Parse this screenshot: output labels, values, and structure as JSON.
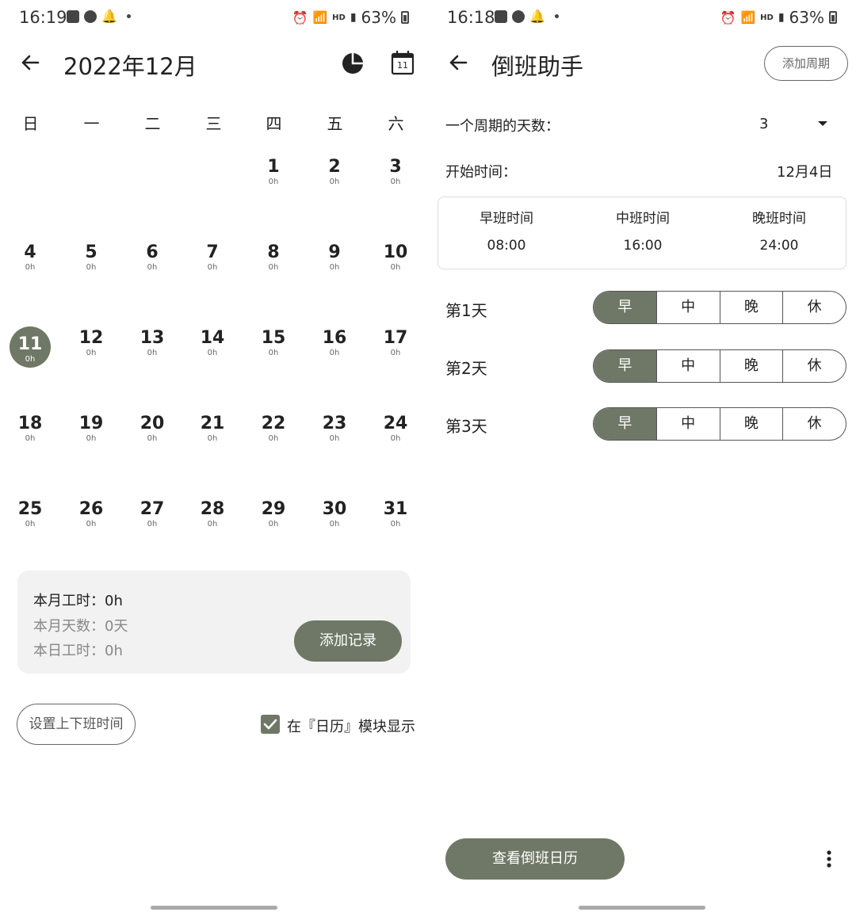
{
  "left": {
    "status": {
      "time": "16:19",
      "battery": "63%",
      "net": "HD"
    },
    "header": {
      "title": "2022年12月",
      "calendar_badge": "11"
    },
    "weekdays": [
      "日",
      "一",
      "二",
      "三",
      "四",
      "五",
      "六"
    ],
    "days": [
      {
        "d": "1",
        "h": "0h"
      },
      {
        "d": "2",
        "h": "0h"
      },
      {
        "d": "3",
        "h": "0h"
      },
      {
        "d": "4",
        "h": "0h"
      },
      {
        "d": "5",
        "h": "0h"
      },
      {
        "d": "6",
        "h": "0h"
      },
      {
        "d": "7",
        "h": "0h"
      },
      {
        "d": "8",
        "h": "0h"
      },
      {
        "d": "9",
        "h": "0h"
      },
      {
        "d": "10",
        "h": "0h"
      },
      {
        "d": "11",
        "h": "0h"
      },
      {
        "d": "12",
        "h": "0h"
      },
      {
        "d": "13",
        "h": "0h"
      },
      {
        "d": "14",
        "h": "0h"
      },
      {
        "d": "15",
        "h": "0h"
      },
      {
        "d": "16",
        "h": "0h"
      },
      {
        "d": "17",
        "h": "0h"
      },
      {
        "d": "18",
        "h": "0h"
      },
      {
        "d": "19",
        "h": "0h"
      },
      {
        "d": "20",
        "h": "0h"
      },
      {
        "d": "21",
        "h": "0h"
      },
      {
        "d": "22",
        "h": "0h"
      },
      {
        "d": "23",
        "h": "0h"
      },
      {
        "d": "24",
        "h": "0h"
      },
      {
        "d": "25",
        "h": "0h"
      },
      {
        "d": "26",
        "h": "0h"
      },
      {
        "d": "27",
        "h": "0h"
      },
      {
        "d": "28",
        "h": "0h"
      },
      {
        "d": "29",
        "h": "0h"
      },
      {
        "d": "30",
        "h": "0h"
      },
      {
        "d": "31",
        "h": "0h"
      }
    ],
    "selected_day": "11",
    "summary": {
      "month_hours": "本月工时：0h",
      "month_days": "本月天数：0天",
      "today_hours": "本日工时：0h",
      "add_record": "添加记录"
    },
    "set_time_button": "设置上下班时间",
    "show_in_calendar": "在『日历』模块显示",
    "show_in_calendar_checked": true
  },
  "right": {
    "status": {
      "time": "16:18",
      "battery": "63%",
      "net": "HD"
    },
    "header": {
      "title": "倒班助手",
      "add_cycle": "添加周期"
    },
    "cycle_days_label": "一个周期的天数：",
    "cycle_days_value": "3",
    "start_time_label": "开始时间：",
    "start_time_value": "12月4日",
    "shifts": [
      {
        "name": "早班时间",
        "time": "08:00"
      },
      {
        "name": "中班时间",
        "time": "16:00"
      },
      {
        "name": "晚班时间",
        "time": "24:00"
      }
    ],
    "shift_options": [
      "早",
      "中",
      "晚",
      "休"
    ],
    "day_rows": [
      {
        "label": "第1天",
        "selected": "早"
      },
      {
        "label": "第2天",
        "selected": "早"
      },
      {
        "label": "第3天",
        "selected": "早"
      }
    ],
    "view_calendar_button": "查看倒班日历"
  },
  "colors": {
    "accent": "#6f7866"
  }
}
